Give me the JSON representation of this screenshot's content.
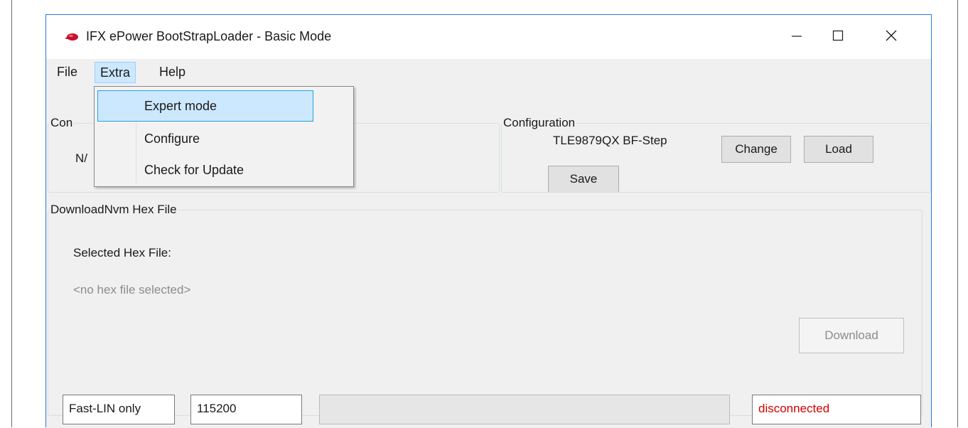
{
  "window": {
    "title": "IFX ePower BootStrapLoader - Basic Mode",
    "icon": "red-chip-icon",
    "accent_color": "#2b79d8"
  },
  "menu": {
    "items": [
      {
        "label": "File",
        "active": false
      },
      {
        "label": "Extra",
        "active": true
      },
      {
        "label": "Help",
        "active": false
      }
    ],
    "dropdown": {
      "items": [
        {
          "label": "Expert mode",
          "highlighted": true
        },
        {
          "label": "Configure",
          "highlighted": false
        },
        {
          "label": "Check for Update",
          "highlighted": false
        }
      ]
    }
  },
  "connection": {
    "group_label_visible": "Con",
    "name_partial": "N/"
  },
  "configuration": {
    "group_label": "Configuration",
    "device": "TLE9879QX BF-Step",
    "change_label": "Change",
    "load_label": "Load",
    "save_label": "Save"
  },
  "download": {
    "group_label": "DownloadNvm Hex File",
    "selected_label": "Selected Hex File:",
    "file_placeholder": "<no hex file selected>",
    "download_label": "Download"
  },
  "status": {
    "mode": "Fast-LIN only",
    "baud": "115200",
    "connection_state": "disconnected",
    "connection_color": "#d40000"
  }
}
